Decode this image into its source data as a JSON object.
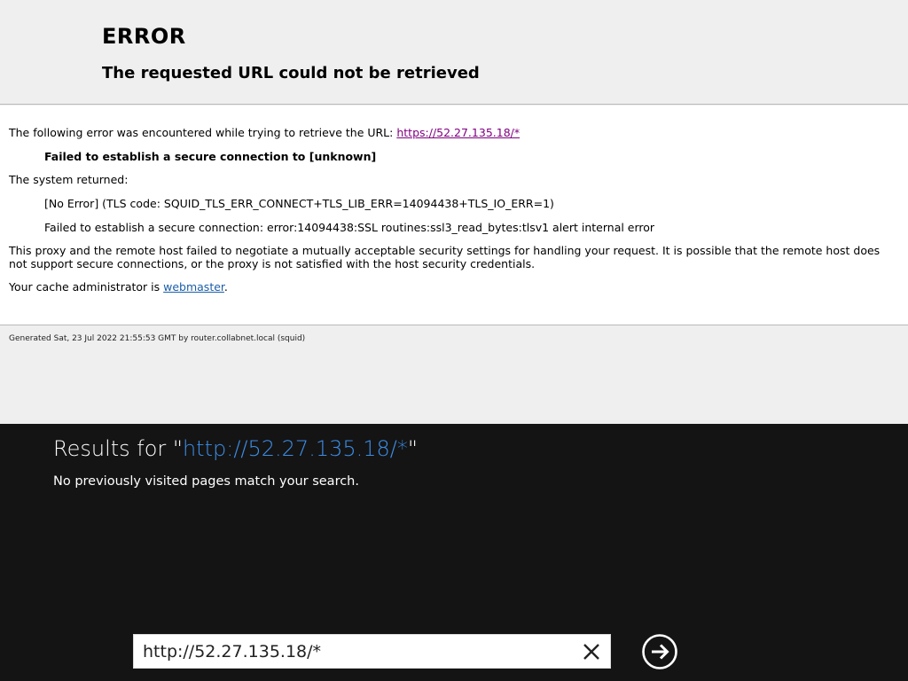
{
  "error_page": {
    "title": "ERROR",
    "subtitle": "The requested URL could not be retrieved",
    "intro_text": "The following error was encountered while trying to retrieve the URL: ",
    "url": "https://52.27.135.18/*",
    "failure_message": "Failed to establish a secure connection to [unknown]",
    "system_returned_label": "The system returned:",
    "tls_code": "[No Error] (TLS code: SQUID_TLS_ERR_CONNECT+TLS_LIB_ERR=14094438+TLS_IO_ERR=1)",
    "ssl_error": "Failed to establish a secure connection: error:14094438:SSL routines:ssl3_read_bytes:tlsv1 alert internal error",
    "description": "This proxy and the remote host failed to negotiate a mutually acceptable security settings for handling your request. It is possible that the remote host does not support secure connections, or the proxy is not satisfied with the host security credentials.",
    "admin_text": "Your cache administrator is ",
    "admin_link": "webmaster",
    "admin_suffix": ".",
    "footer": "Generated Sat, 23 Jul 2022 21:55:53 GMT by router.collabnet.local (squid)"
  },
  "search": {
    "results_prefix": "Results for \"",
    "results_query": "http://52.27.135.18/*",
    "results_suffix": "\"",
    "no_results": "No previously visited pages match your search.",
    "input_value": "http://52.27.135.18/*",
    "clear_icon": "close-icon",
    "go_icon": "arrow-right-circle-icon"
  },
  "colors": {
    "panel_bg": "#141414",
    "query_accent": "#3d8ee8",
    "visited_link": "#800080",
    "link": "#1a5ea8"
  }
}
